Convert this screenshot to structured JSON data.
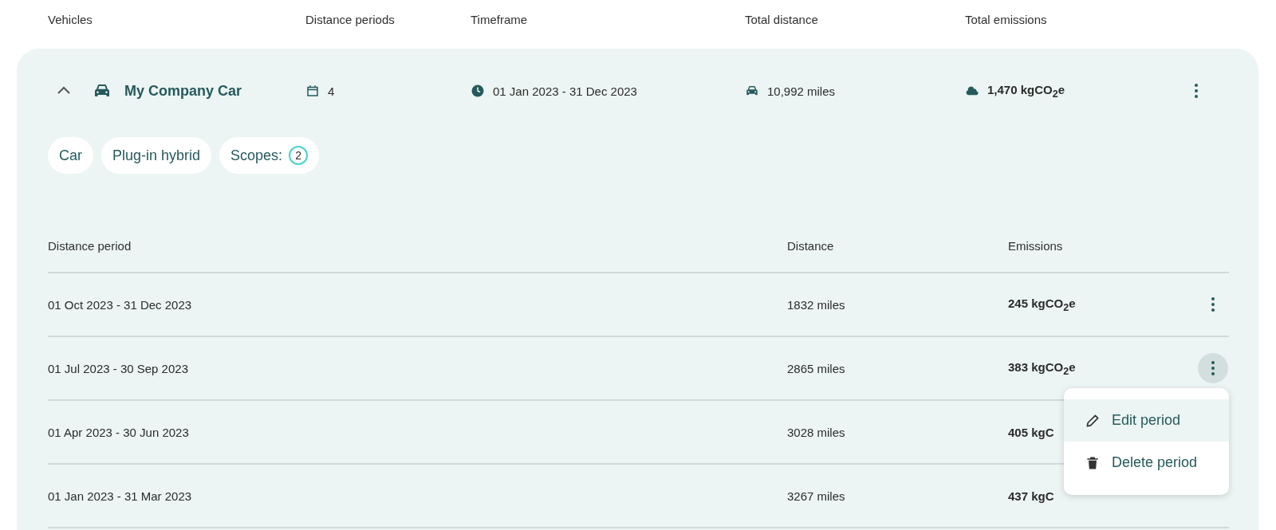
{
  "columns": [
    "Vehicles",
    "Distance periods",
    "Timeframe",
    "Total distance",
    "Total emissions"
  ],
  "vehicle": {
    "name": "My Company Car",
    "expanded": true,
    "periods_count": "4",
    "timeframe": "01 Jan 2023 - 31 Dec 2023",
    "distance": "10,992 miles",
    "emissions": "1,470 kgCO$_{2}$e",
    "tags": [
      {
        "kind": "plain",
        "label": "Car"
      },
      {
        "kind": "plain",
        "label": "Plug-in hybrid"
      },
      {
        "kind": "count",
        "label": "Scopes:",
        "count": "2"
      }
    ],
    "period_columns": [
      "Distance period",
      "Distance",
      "Emissions"
    ],
    "periods": [
      {
        "period": "01 Oct 2023 - 31 Dec 2023",
        "distance": "1832 miles",
        "emissions": "245 kgCO$_{2}$e",
        "menu_open": false,
        "covered": false
      },
      {
        "period": "01 Jul 2023 - 30 Sep 2023",
        "distance": "2865 miles",
        "emissions": "383 kgCO$_{2}$e",
        "menu_open": true,
        "covered": false
      },
      {
        "period": "01 Apr 2023 - 30 Jun 2023",
        "distance": "3028 miles",
        "emissions": "405 kgC",
        "menu_open": false,
        "covered": true
      },
      {
        "period": "01 Jan 2023 - 31 Mar 2023",
        "distance": "3267 miles",
        "emissions": "437 kgC",
        "menu_open": false,
        "covered": true
      }
    ],
    "menu": [
      {
        "kind": "edit",
        "label": "Edit period",
        "selected": true
      },
      {
        "kind": "delete",
        "label": "Delete period",
        "selected": false
      }
    ]
  }
}
